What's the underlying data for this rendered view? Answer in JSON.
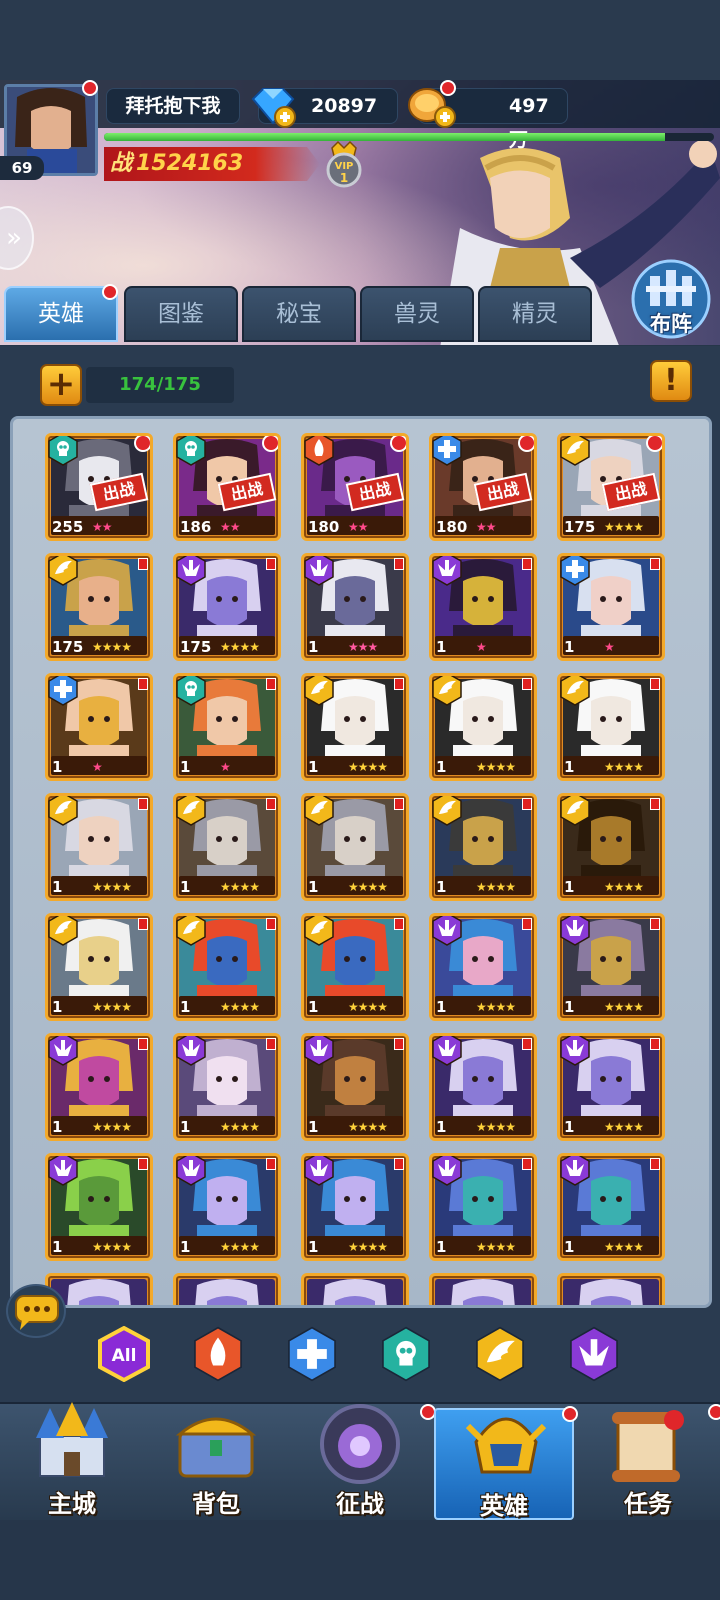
{
  "player": {
    "name": "拜托抱下我",
    "level": "69",
    "gems": "20897",
    "gold": "497万",
    "power_prefix": "战",
    "power": "1524163",
    "vip": "1",
    "xp_fraction": 0.92
  },
  "tabs": [
    {
      "label": "英雄",
      "active": true
    },
    {
      "label": "图鉴",
      "active": false
    },
    {
      "label": "秘宝",
      "active": false
    },
    {
      "label": "兽灵",
      "active": false
    },
    {
      "label": "精灵",
      "active": false
    }
  ],
  "formation_label": "布阵",
  "hero_count": "174/175",
  "grid": {
    "rows": [
      [
        {
          "level": "255",
          "faction": "skull",
          "stars": 2,
          "in_battle": true,
          "red": true,
          "theme": "dark"
        },
        {
          "level": "186",
          "faction": "skull",
          "stars": 2,
          "in_battle": true,
          "red": true,
          "theme": "elf"
        },
        {
          "level": "180",
          "faction": "fire",
          "stars": 2,
          "in_battle": true,
          "red": true,
          "theme": "purple"
        },
        {
          "level": "180",
          "faction": "cross",
          "stars": 2,
          "in_battle": true,
          "red": true,
          "theme": "human"
        },
        {
          "level": "175",
          "faction": "wing",
          "stars": 4,
          "in_battle": true,
          "red": true,
          "theme": "sage"
        }
      ],
      [
        {
          "level": "175",
          "faction": "wing",
          "stars": 4,
          "in_battle": false,
          "theme": "elfm"
        },
        {
          "level": "175",
          "faction": "demon",
          "stars": 4,
          "in_battle": false,
          "theme": "violet"
        },
        {
          "level": "1",
          "faction": "demon",
          "stars": 3,
          "in_battle": false,
          "theme": "darkelf"
        },
        {
          "level": "1",
          "faction": "demon",
          "stars": 1,
          "in_battle": false,
          "theme": "mask"
        },
        {
          "level": "1",
          "faction": "cross",
          "stars": 1,
          "in_battle": false,
          "theme": "witch"
        }
      ],
      [
        {
          "level": "1",
          "faction": "cross",
          "stars": 1,
          "in_battle": false,
          "theme": "gold"
        },
        {
          "level": "1",
          "faction": "skull",
          "stars": 1,
          "in_battle": false,
          "theme": "elfg"
        },
        {
          "level": "1",
          "faction": "wing",
          "stars": 4,
          "in_battle": false,
          "theme": "white"
        },
        {
          "level": "1",
          "faction": "wing",
          "stars": 4,
          "in_battle": false,
          "theme": "white"
        },
        {
          "level": "1",
          "faction": "wing",
          "stars": 4,
          "in_battle": false,
          "theme": "white"
        }
      ],
      [
        {
          "level": "1",
          "faction": "wing",
          "stars": 4,
          "in_battle": false,
          "theme": "sage"
        },
        {
          "level": "1",
          "faction": "wing",
          "stars": 4,
          "in_battle": false,
          "theme": "knight"
        },
        {
          "level": "1",
          "faction": "wing",
          "stars": 4,
          "in_battle": false,
          "theme": "knight"
        },
        {
          "level": "1",
          "faction": "wing",
          "stars": 4,
          "in_battle": false,
          "theme": "anubis"
        },
        {
          "level": "1",
          "faction": "wing",
          "stars": 4,
          "in_battle": false,
          "theme": "anubis2"
        }
      ],
      [
        {
          "level": "1",
          "faction": "wing",
          "stars": 4,
          "in_battle": false,
          "theme": "goldmask"
        },
        {
          "level": "1",
          "faction": "wing",
          "stars": 4,
          "in_battle": false,
          "theme": "troll"
        },
        {
          "level": "1",
          "faction": "wing",
          "stars": 4,
          "in_battle": false,
          "theme": "troll"
        },
        {
          "level": "1",
          "faction": "demon",
          "stars": 4,
          "in_battle": false,
          "theme": "siren"
        },
        {
          "level": "1",
          "faction": "demon",
          "stars": 4,
          "in_battle": false,
          "theme": "armor"
        }
      ],
      [
        {
          "level": "1",
          "faction": "demon",
          "stars": 4,
          "in_battle": false,
          "theme": "pharaoh"
        },
        {
          "level": "1",
          "faction": "demon",
          "stars": 4,
          "in_battle": false,
          "theme": "pale"
        },
        {
          "level": "1",
          "faction": "demon",
          "stars": 4,
          "in_battle": false,
          "theme": "samurai"
        },
        {
          "level": "1",
          "faction": "demon",
          "stars": 4,
          "in_battle": false,
          "theme": "violet"
        },
        {
          "level": "1",
          "faction": "demon",
          "stars": 4,
          "in_battle": false,
          "theme": "violet"
        }
      ],
      [
        {
          "level": "1",
          "faction": "demon",
          "stars": 4,
          "in_battle": false,
          "theme": "toad"
        },
        {
          "level": "1",
          "faction": "demon",
          "stars": 4,
          "in_battle": false,
          "theme": "siren2"
        },
        {
          "level": "1",
          "faction": "demon",
          "stars": 4,
          "in_battle": false,
          "theme": "siren2"
        },
        {
          "level": "1",
          "faction": "demon",
          "stars": 4,
          "in_battle": false,
          "theme": "medusa"
        },
        {
          "level": "1",
          "faction": "demon",
          "stars": 4,
          "in_battle": false,
          "theme": "medusa"
        }
      ]
    ],
    "in_battle_label": "出战"
  },
  "filters": [
    {
      "label": "All",
      "icon": "all-icon",
      "color": "#ffd23a"
    },
    {
      "label": "",
      "icon": "fire-faction-icon",
      "color": "#e8562a"
    },
    {
      "label": "",
      "icon": "cross-faction-icon",
      "color": "#3a8ae8"
    },
    {
      "label": "",
      "icon": "skull-faction-icon",
      "color": "#25b2a0"
    },
    {
      "label": "",
      "icon": "wing-faction-icon",
      "color": "#f2b81a"
    },
    {
      "label": "",
      "icon": "demon-faction-icon",
      "color": "#8a3ad6"
    }
  ],
  "nav": [
    {
      "label": "主城",
      "icon": "castle-icon",
      "active": false,
      "red": false
    },
    {
      "label": "背包",
      "icon": "chest-icon",
      "active": false,
      "red": false
    },
    {
      "label": "征战",
      "icon": "dragon-portal-icon",
      "active": false,
      "red": true
    },
    {
      "label": "英雄",
      "icon": "hero-helmet-icon",
      "active": true,
      "red": true
    },
    {
      "label": "任务",
      "icon": "scroll-icon",
      "active": false,
      "red": true
    }
  ],
  "colors": {
    "accent_tab": "#3a8ee0",
    "count_green": "#38c23e",
    "card_border": "#f3a92a",
    "red_dot": "#e0262a"
  }
}
